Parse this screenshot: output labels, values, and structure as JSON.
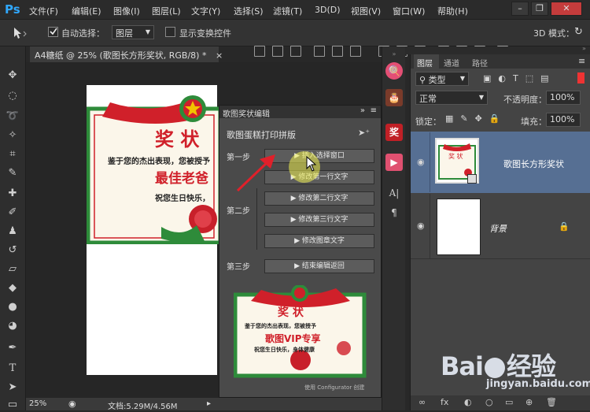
{
  "app": {
    "logo": "Ps",
    "menus": [
      "文件(F)",
      "编辑(E)",
      "图像(I)",
      "图层(L)",
      "文字(Y)",
      "选择(S)",
      "滤镜(T)",
      "3D(D)",
      "视图(V)",
      "窗口(W)",
      "帮助(H)"
    ],
    "win_buttons": [
      "–",
      "❐",
      "✕"
    ]
  },
  "options": {
    "auto_select_label": "自动选择：",
    "auto_select_value": "图层",
    "show_transform_label": "显示变换控件",
    "mode3d_label": "3D 模式："
  },
  "document": {
    "tab_title": "A4糖纸 @ 25% (歌图长方形奖状, RGB/8) *",
    "tab_close": "×",
    "zoom": "25%",
    "doc_info": "文档:5.29M/4.56M"
  },
  "certificate": {
    "title": "奖 状",
    "line1": "鉴于您的杰出表现，您被授予",
    "award": "最佳老爸",
    "line2": "祝您生日快乐，"
  },
  "actions": {
    "panel_title": "歌图奖状编辑",
    "subtitle": "歌图蛋糕打印拼版",
    "steps": [
      {
        "label": "第一步"
      },
      {
        "label": "第二步"
      },
      {
        "label": "第三步"
      }
    ],
    "buttons": [
      "插入选择窗口",
      "修改第一行文字",
      "修改第二行文字",
      "修改第三行文字",
      "修改图章文字",
      "结束编辑返回"
    ],
    "preview": {
      "title": "奖 状",
      "line1": "鉴于您的杰出表现，您被授予",
      "award": "歌图VIP专享",
      "line2": "祝您生日快乐，身体健康"
    },
    "footer": "使用 Configurator 创建"
  },
  "layers_panel": {
    "tabs": [
      "图层",
      "通道",
      "路径"
    ],
    "kind_label": "类型",
    "blend_mode": "正常",
    "opacity_label": "不透明度：",
    "opacity_value": "100%",
    "lock_label": "锁定：",
    "fill_label": "填充：",
    "fill_value": "100%",
    "layers": [
      {
        "name": "歌图长方形奖状",
        "selected": true
      },
      {
        "name": "背景",
        "locked": true
      }
    ]
  },
  "footer_icons": [
    "∞",
    "fx",
    "◐",
    "○",
    "▭",
    "⊕",
    "🗑"
  ],
  "watermark": {
    "brand_left": "Bai",
    "brand_right": "经验",
    "url": "jingyan.baidu.com"
  },
  "colors": {
    "accent": "#30a8ff",
    "selected_layer": "#566f93",
    "cert_red": "#d0202a",
    "cert_green": "#2e8b3a"
  }
}
